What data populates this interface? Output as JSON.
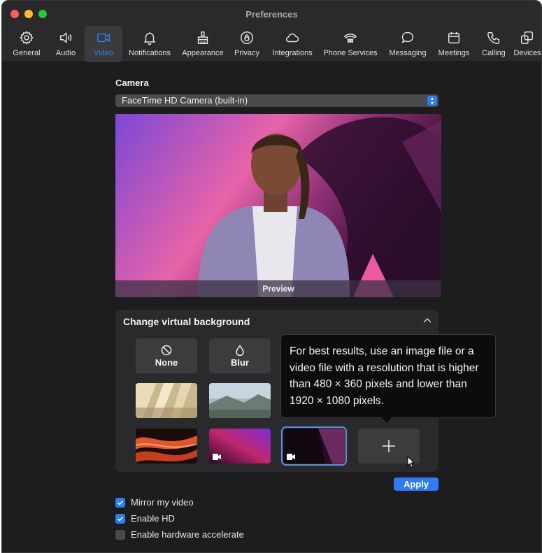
{
  "window": {
    "title": "Preferences"
  },
  "toolbar": {
    "items": [
      {
        "label": "General",
        "icon": "gear-icon"
      },
      {
        "label": "Audio",
        "icon": "speaker-icon"
      },
      {
        "label": "Video",
        "icon": "video-camera-icon",
        "active": true
      },
      {
        "label": "Notifications",
        "icon": "bell-icon"
      },
      {
        "label": "Appearance",
        "icon": "appearance-icon"
      },
      {
        "label": "Privacy",
        "icon": "privacy-icon"
      },
      {
        "label": "Integrations",
        "icon": "cloud-icon"
      },
      {
        "label": "Phone Services",
        "icon": "phone-services-icon"
      },
      {
        "label": "Messaging",
        "icon": "chat-bubble-icon"
      },
      {
        "label": "Meetings",
        "icon": "calendar-icon"
      },
      {
        "label": "Calling",
        "icon": "phone-icon"
      },
      {
        "label": "Devices",
        "icon": "devices-icon"
      }
    ]
  },
  "camera": {
    "label": "Camera",
    "selected": "FaceTime HD Camera (built-in)"
  },
  "preview": {
    "label": "Preview"
  },
  "virtual_background": {
    "title": "Change virtual background",
    "none_label": "None",
    "blur_label": "Blur"
  },
  "tooltip": {
    "text": "For best results, use an image file or a video file with a resolution that is higher than 480 × 360 pixels and lower than 1920 × 1080 pixels."
  },
  "apply_label": "Apply",
  "options": {
    "mirror_label": "Mirror my video",
    "mirror_checked": true,
    "hd_label": "Enable HD",
    "hd_checked": true,
    "hw_label": "Enable hardware accelerate",
    "hw_checked": false
  },
  "colors": {
    "accent": "#2f7bf6",
    "window_bg": "#1d1d1f",
    "panel_bg": "#2a2a2c"
  }
}
